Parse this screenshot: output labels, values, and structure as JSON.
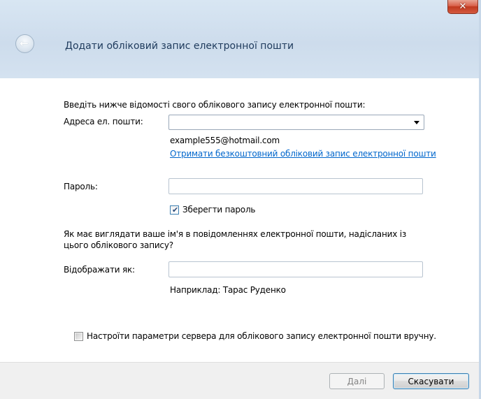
{
  "window": {
    "title": "Додати обліковий запис електронної пошти",
    "close_glyph": "✕",
    "back_glyph": "←"
  },
  "form": {
    "intro": "Введіть нижче відомості свого облікового запису електронної пошти:",
    "email": {
      "label": "Адреса ел. пошти:",
      "value": "",
      "example": "example555@hotmail.com",
      "get_free_link": "Отримати безкоштовний обліковий запис електронної пошти"
    },
    "password": {
      "label": "Пароль:",
      "value": ""
    },
    "save_password": {
      "label": "Зберегти пароль",
      "checked": true
    },
    "display_question_line1": "Як має виглядати ваше ім'я в повідомленнях електронної пошти, надісланих із",
    "display_question_line2": "цього облікового запису?",
    "display_as": {
      "label": "Відображати як:",
      "value": "",
      "example": "Наприклад: Тарас Руденко"
    },
    "manual_server": {
      "label": "Настроїти параметри сервера для облікового запису електронної пошти вручну.",
      "checked": false
    }
  },
  "footer": {
    "next_label": "Далі",
    "cancel_label": "Скасувати"
  },
  "colors": {
    "link": "#0066cc",
    "title_text": "#1e3a5c",
    "footer_bg": "#f0f0f0",
    "close_red": "#c0391f"
  }
}
